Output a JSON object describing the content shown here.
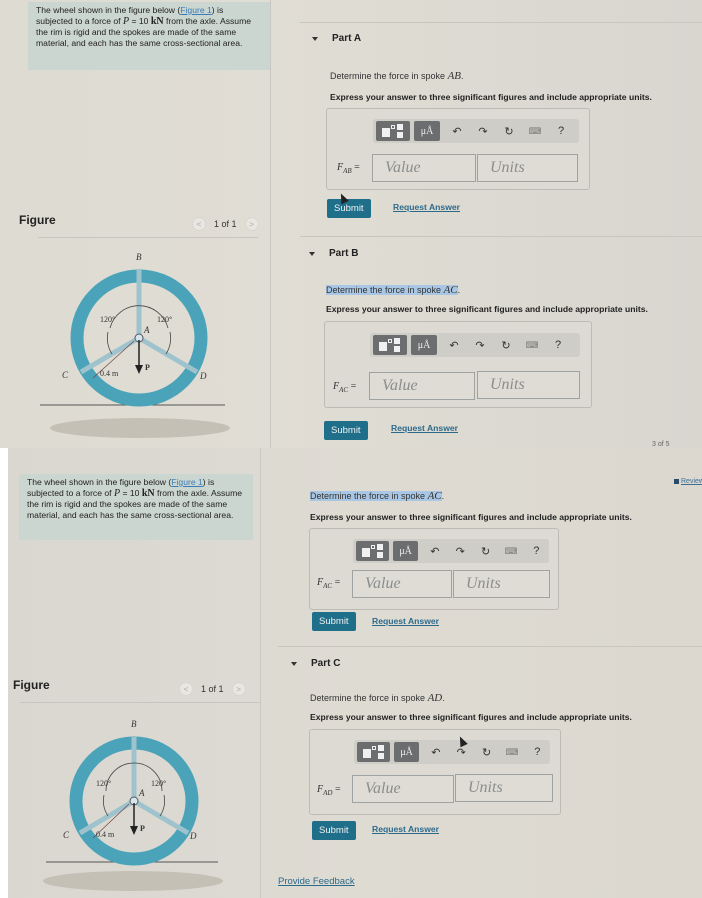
{
  "problem": {
    "text_before_link": "The wheel shown in the figure below (",
    "link": "Figure 1",
    "text_after_link": ") is subjected to a force of ",
    "force_var": "P",
    "force_eq": " = 10 ",
    "force_unit": "kN",
    "text_end": " from the axle. Assume the rim is rigid and the spokes are made of the same material, and each has the same cross-sectional area."
  },
  "figure": {
    "title": "Figure",
    "pager": "1 of 1",
    "prev_icon": "chevron-left-icon",
    "next_icon": "chevron-right-icon",
    "labels": {
      "B": "B",
      "A": "A",
      "C": "C",
      "D": "D",
      "P": "P",
      "angle_left": "120°",
      "angle_right": "120°",
      "radius": "0.4 m"
    },
    "colors": {
      "rim": "#4aa3b8",
      "spoke": "#9fc3cc"
    }
  },
  "toolbar": {
    "template_icon": "templates-icon",
    "units_label": "μÅ",
    "undo_icon": "↶",
    "redo_icon": "↷",
    "reset_icon": "↻",
    "keyboard_icon": "⌨",
    "help_icon": "?"
  },
  "parts": {
    "A": {
      "header": "Part A",
      "question_prefix": "Determine the force in spoke ",
      "spoke": "AB",
      "instruction": "Express your answer to three significant figures and include appropriate units.",
      "var": "F",
      "sub": "AB",
      "eq": " =",
      "value_placeholder": "Value",
      "units_placeholder": "Units",
      "submit": "Submit",
      "request": "Request Answer"
    },
    "B": {
      "header": "Part B",
      "question_prefix": "Determine the force in spoke ",
      "spoke": "AC",
      "instruction": "Express your answer to three significant figures and include appropriate units.",
      "var": "F",
      "sub": "AC",
      "eq": " =",
      "value_placeholder": "Value",
      "units_placeholder": "Units",
      "submit": "Submit",
      "request": "Request Answer"
    },
    "C": {
      "header": "Part C",
      "question_prefix": "Determine the force in spoke ",
      "spoke": "AD",
      "instruction": "Express your answer to three significant figures and include appropriate units.",
      "var": "F",
      "sub": "AD",
      "eq": " =",
      "value_placeholder": "Value",
      "units_placeholder": "Units",
      "submit": "Submit",
      "request": "Request Answer"
    }
  },
  "corner": {
    "pager": "3 of 5",
    "review": "Review"
  },
  "feedback": "Provide Feedback",
  "colors": {
    "submit": "#1f6f8b",
    "link": "#2c6a8a",
    "highlight": "#a9c7e4",
    "problem_bg": "#ccd6d0"
  }
}
